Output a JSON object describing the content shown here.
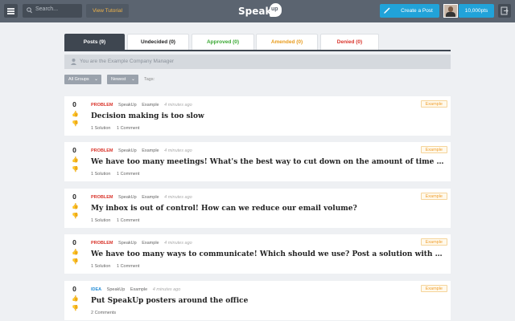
{
  "header": {
    "search_placeholder": "Search...",
    "tutorial_label": "View Tutorial",
    "logo_text": "Speak",
    "logo_bubble": "up",
    "create_label": "Create a Post",
    "points": "10,000pts"
  },
  "tabs": [
    {
      "label": "Posts (9)",
      "color": "#ffffff"
    },
    {
      "label": "Undecided (0)",
      "color": "#222222"
    },
    {
      "label": "Approved (0)",
      "color": "#3aa832"
    },
    {
      "label": "Amended (0)",
      "color": "#e89b1c"
    },
    {
      "label": "Denied (0)",
      "color": "#d9342b"
    }
  ],
  "manager_text": "You are the Example Company Manager",
  "filters": {
    "groups_label": "All Groups",
    "sort_label": "Newest",
    "tags_label": "Tags:"
  },
  "posts": [
    {
      "votes": "0",
      "type": "PROBLEM",
      "app": "SpeakUp",
      "group": "Example",
      "time": "4 minutes ago",
      "title": "Decision making is too slow",
      "stat1": "1 Solution",
      "stat2": "1 Comment",
      "badge": "Example"
    },
    {
      "votes": "0",
      "type": "PROBLEM",
      "app": "SpeakUp",
      "group": "Example",
      "time": "4 minutes ago",
      "title": "We have too many meetings! What's the best way to cut down on the amount of time we spend in meetings?",
      "stat1": "1 Solution",
      "stat2": "1 Comment",
      "badge": "Example"
    },
    {
      "votes": "0",
      "type": "PROBLEM",
      "app": "SpeakUp",
      "group": "Example",
      "time": "4 minutes ago",
      "title": "My inbox is out of control! How can we reduce our email volume?",
      "stat1": "1 Solution",
      "stat2": "1 Comment",
      "badge": "Example"
    },
    {
      "votes": "0",
      "type": "PROBLEM",
      "app": "SpeakUp",
      "group": "Example",
      "time": "4 minutes ago",
      "title": "We have too many ways to communicate! Which should we use? Post a solution with your favorite tool!",
      "stat1": "1 Solution",
      "stat2": "1 Comment",
      "badge": "Example"
    },
    {
      "votes": "0",
      "type": "IDEA",
      "app": "SpeakUp",
      "group": "Example",
      "time": "4 minutes ago",
      "title": "Put SpeakUp posters around the office",
      "stat1": "2 Comments",
      "stat2": "",
      "badge": "Example"
    }
  ],
  "icons": {
    "menu": "hamburger-icon",
    "search": "search-icon",
    "edit": "pencil-icon",
    "exit": "logout-icon",
    "user": "user-icon",
    "upvote": "thumbs-up-icon",
    "downvote": "thumbs-down-icon"
  }
}
